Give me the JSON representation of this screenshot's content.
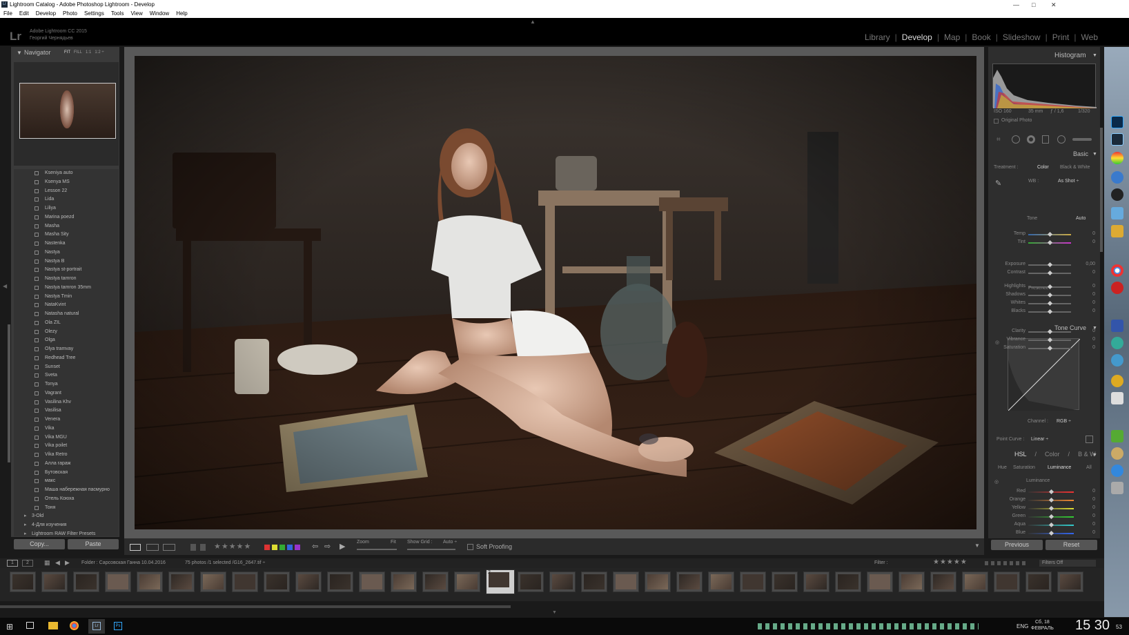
{
  "window": {
    "title": "Lightroom Catalog - Adobe Photoshop Lightroom - Develop",
    "menu": [
      "File",
      "Edit",
      "Develop",
      "Photo",
      "Settings",
      "Tools",
      "View",
      "Window",
      "Help"
    ]
  },
  "identity": {
    "logo": "Lr",
    "product": "Adobe Lightroom CC 2015",
    "user": "Георгий Чернядьев"
  },
  "modules": [
    "Library",
    "Develop",
    "Map",
    "Book",
    "Slideshow",
    "Print",
    "Web"
  ],
  "active_module": "Develop",
  "navigator": {
    "title": "Navigator",
    "zooms": [
      "FIT",
      "FILL",
      "1:1",
      "1:2 ÷"
    ]
  },
  "folders": [
    "Kseniya auto",
    "Ksenya MS",
    "Lesson 22",
    "Lida",
    "Liliya",
    "Marina poezd",
    "Masha",
    "Masha Sity",
    "Nastenka",
    "Nastya",
    "Nastya B",
    "Nastya st-portrait",
    "Nastya tamron",
    "Nastya tamron 35mm",
    "Nastya Tmin",
    "NataKvint",
    "Natasha natural",
    "Ola ZIL",
    "Olezy",
    "Olga",
    "Olya tramvay",
    "Redhead Tree",
    "Sunset",
    "Sveta",
    "Tonya",
    "Vagrant",
    "Vasilina Khv",
    "Vasilisa",
    "Venera",
    "Vika",
    "Vika MGU",
    "Vika poilet",
    "Vika Retro",
    "Алла гараж",
    "Бутовская",
    "макс",
    "Маша набережная пасмурно",
    "Отель Коюха",
    "Тоня"
  ],
  "folder_groups": [
    "3-Old",
    "4-Для изучения",
    "Lightroom RAW Filter Presets"
  ],
  "left_buttons": {
    "copy": "Copy...",
    "paste": "Paste"
  },
  "toolbar": {
    "zoom": "Zoom",
    "fit": "Fit",
    "show_grid": "Show Grid :",
    "grid_value": "Auto ÷",
    "soft_proofing": "Soft Proofing"
  },
  "histogram": {
    "title": "Histogram",
    "iso": "ISO 160",
    "focal": "35 mm",
    "aperture": "ƒ / 1,6",
    "shutter": "1/320",
    "original_photo": "Original Photo"
  },
  "basic": {
    "title": "Basic",
    "treatment_label": "Treatment :",
    "treatment_color": "Color",
    "treatment_bw": "Black & White",
    "wb_label": "WB :",
    "wb_value": "As Shot ÷",
    "tone_label": "Tone",
    "auto": "Auto",
    "presence_label": "Presence",
    "sliders": [
      {
        "label": "Temp",
        "value": "0"
      },
      {
        "label": "Tint",
        "value": "0"
      },
      {
        "label": "Exposure",
        "value": "0,00"
      },
      {
        "label": "Contrast",
        "value": "0"
      },
      {
        "label": "Highlights",
        "value": "0"
      },
      {
        "label": "Shadows",
        "value": "0"
      },
      {
        "label": "Whites",
        "value": "0"
      },
      {
        "label": "Blacks",
        "value": "0"
      },
      {
        "label": "Clarity",
        "value": "0"
      },
      {
        "label": "Vibrance",
        "value": "0"
      },
      {
        "label": "Saturation",
        "value": "0"
      }
    ]
  },
  "tone_curve": {
    "title": "Tone Curve",
    "channel_label": "Channel :",
    "channel_value": "RGB ÷",
    "point_curve_label": "Point Curve :",
    "point_curve_value": "Linear ÷"
  },
  "hsl": {
    "tabs": [
      "HSL",
      "Color",
      "B & W"
    ],
    "subtabs": [
      "Hue",
      "Saturation",
      "Luminance",
      "All"
    ],
    "active_subtab": "Luminance",
    "section": "Luminance",
    "rows": [
      {
        "label": "Red",
        "value": "0"
      },
      {
        "label": "Orange",
        "value": "0"
      },
      {
        "label": "Yellow",
        "value": "0"
      },
      {
        "label": "Green",
        "value": "0"
      },
      {
        "label": "Aqua",
        "value": "0"
      },
      {
        "label": "Blue",
        "value": "0"
      }
    ]
  },
  "right_buttons": {
    "previous": "Previous",
    "reset": "Reset"
  },
  "filmstrip": {
    "path": "Folder : Сарсовская Ганна 10.04.2016",
    "count": "75 photos /1 selected /G16_2647.tif ÷",
    "filter_label": "Filter :",
    "filters_off": "Filters Off",
    "thumb_count": 34,
    "selected_index": 15,
    "selected_number": "2"
  },
  "taskbar": {
    "lang": "ENG",
    "date_day": "Сб, 18",
    "date_month": "ФЕВРАЛЬ",
    "time": "15 30",
    "seconds": "53"
  },
  "colors": {
    "accent_label": "#ddd",
    "panel": "#2e2e2e",
    "background": "#1a1a1a"
  }
}
